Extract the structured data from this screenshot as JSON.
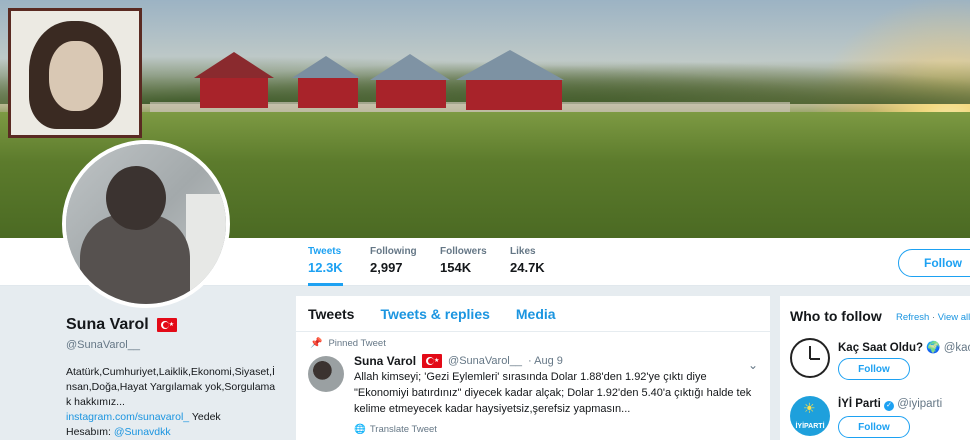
{
  "profile": {
    "name": "Suna Varol",
    "handle": "@SunaVarol__",
    "bio": "Atatürk,Cumhuriyet,Laiklik,Ekonomi,Siyaset,İnsan,Doğa,Hayat Yargılamak yok,Sorgulamak hakkımız...",
    "link": "instagram.com/sunavarol_",
    "bio_tail": " Yedek",
    "backup_label": "Hesabım: ",
    "backup_handle": "@Sunavdkk"
  },
  "stats": [
    {
      "label": "Tweets",
      "value": "12.3K"
    },
    {
      "label": "Following",
      "value": "2,997"
    },
    {
      "label": "Followers",
      "value": "154K"
    },
    {
      "label": "Likes",
      "value": "24.7K"
    }
  ],
  "follow_label": "Follow",
  "tabs": [
    "Tweets",
    "Tweets & replies",
    "Media"
  ],
  "tweet": {
    "pinned_label": "Pinned Tweet",
    "name": "Suna Varol",
    "handle": "@SunaVarol__",
    "date": "· Aug 9",
    "text": "Allah kimseyi; 'Gezi Eylemleri' sırasında Dolar 1.88'den 1.92'ye çıktı diye \"Ekonomiyi batırdınız\" diyecek kadar alçak; Dolar 1.92'den 5.40'a çıktığı halde tek kelime etmeyecek kadar haysiyetsiz,şerefsiz yapmasın...",
    "translate": "Translate Tweet"
  },
  "who_to_follow": {
    "title": "Who to follow",
    "refresh": "Refresh",
    "sep": " · ",
    "view_all": "View all",
    "suggestions": [
      {
        "name": "Kaç Saat Oldu?",
        "handle": "@kacsa",
        "follow": "Follow"
      },
      {
        "name": "İYİ Parti",
        "handle": "@iyiparti",
        "follow": "Follow",
        "logo_text": "İYİPARTİ"
      }
    ]
  },
  "colors": {
    "accent": "#1da1f2",
    "link": "#1b95e0",
    "flag_red": "#e30a17"
  }
}
